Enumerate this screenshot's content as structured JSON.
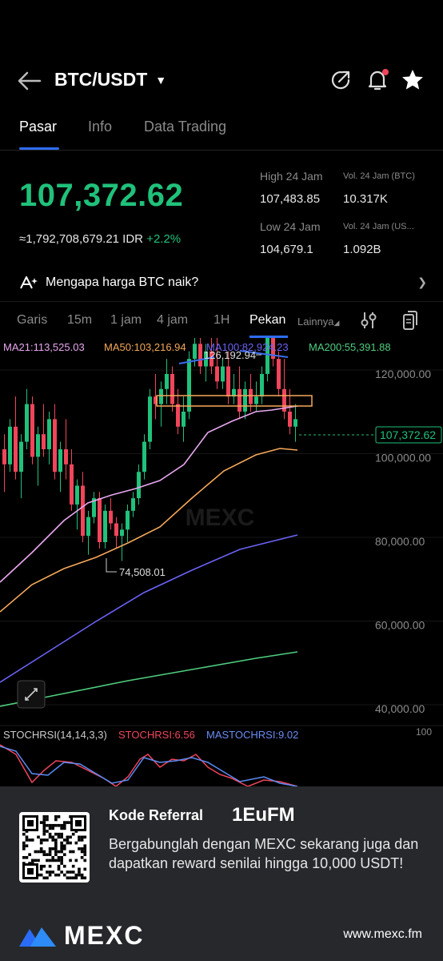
{
  "header": {
    "pair": "BTC/USDT",
    "icons": [
      "back-arrow-icon",
      "caret-down-icon",
      "share-icon",
      "bell-icon",
      "star-icon"
    ]
  },
  "tabs": [
    "Pasar",
    "Info",
    "Data Trading"
  ],
  "price": {
    "last": "107,372.62",
    "idr": "≈1,792,708,679.21 IDR",
    "change": "+2.2%"
  },
  "stats": {
    "high_label": "High 24 Jam",
    "high_value": "107,483.85",
    "vol_btc_label": "Vol. 24 Jam (BTC)",
    "vol_btc_value": "10.317K",
    "low_label": "Low 24 Jam",
    "low_value": "104,679.1",
    "vol_usdt_label": "Vol. 24 Jam (US...",
    "vol_usdt_value": "1.092B"
  },
  "why": {
    "text": "Mengapa harga BTC naik?"
  },
  "intervals": [
    "Garis",
    "15m",
    "1 jam",
    "4 jam",
    "1H",
    "Pekan",
    "Lainnya"
  ],
  "chart": {
    "ma21": "MA21:113,525.03",
    "ma50": "MA50:103,216.94",
    "ma100": "MA100:82,924.23",
    "ma200": "MA200:55,391.88",
    "high_marker": "126,192.94",
    "low_marker": "74,508.01",
    "current_price_tag": "107,372.62",
    "axis_labels": [
      "120,000.00",
      "100,000.00",
      "80,000.00",
      "60,000.00",
      "40,000.00"
    ],
    "stoch_label": "STOCHRSI(14,14,3,3)",
    "stoch_value": "STOCHRSI:6.56",
    "mastoch_value": "MASTOCHRSI:9.02",
    "stoch_axis": "100",
    "watermark": "MEXC",
    "colors": {
      "up": "#20c17a",
      "down": "#f0455a",
      "ma21": "#e8a7f0",
      "ma50": "#f5a85a",
      "ma100": "#6b63f5",
      "ma200": "#4fce7f"
    }
  },
  "banner": {
    "ref_label": "Kode Referral",
    "ref_code": "1EuFM",
    "text": "Bergabunglah dengan MEXC sekarang juga dan dapatkan reward senilai hingga 10,000 USDT!",
    "logo": "MEXC",
    "site": "www.mexc.fm"
  }
}
